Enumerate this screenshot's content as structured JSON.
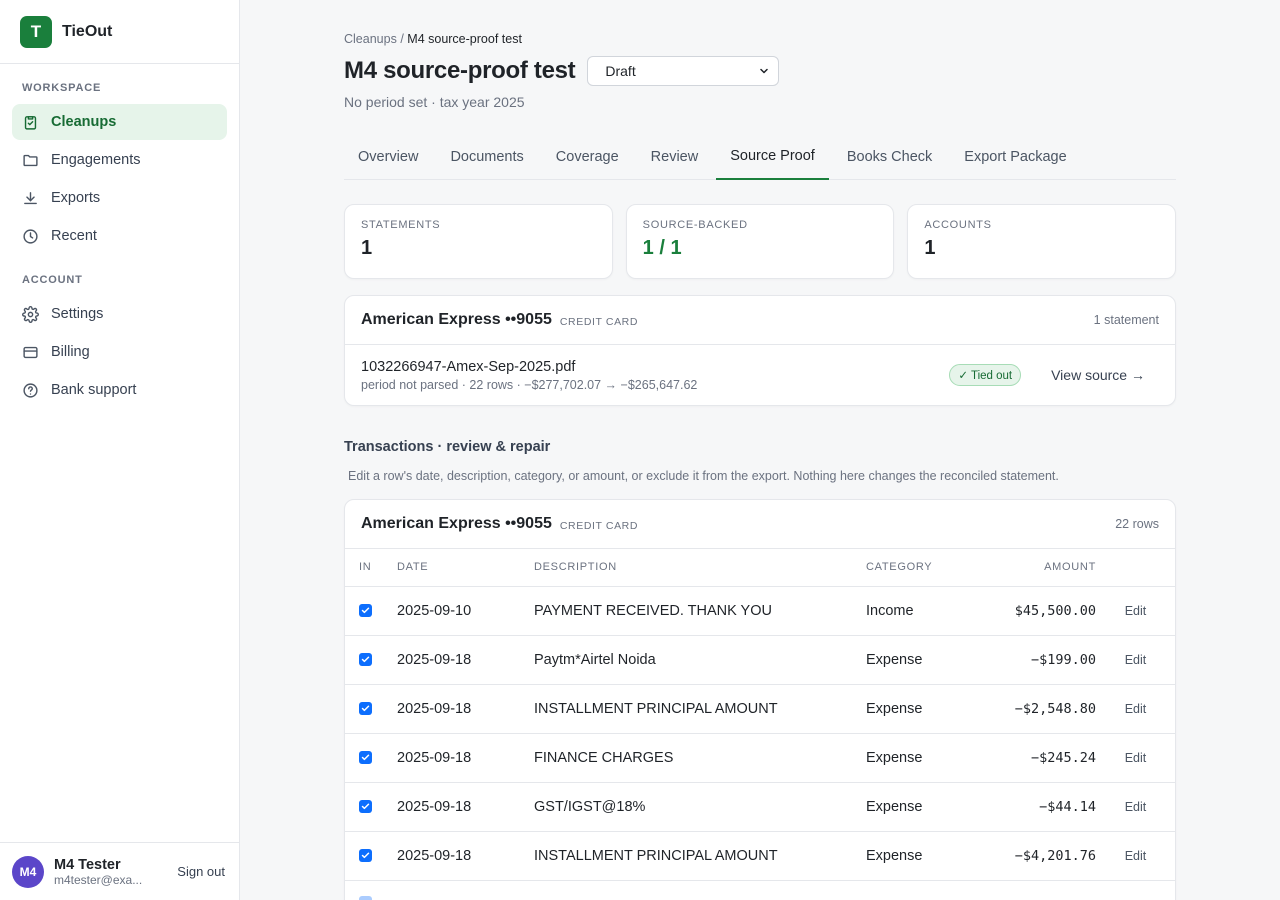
{
  "app": {
    "logo_letter": "T",
    "name": "TieOut"
  },
  "sidebar": {
    "sections": [
      {
        "heading": "WORKSPACE",
        "items": [
          {
            "label": "Cleanups",
            "icon": "check-clipboard-icon",
            "active": true
          },
          {
            "label": "Engagements",
            "icon": "folder-icon",
            "active": false
          },
          {
            "label": "Exports",
            "icon": "download-icon",
            "active": false
          },
          {
            "label": "Recent",
            "icon": "clock-icon",
            "active": false
          }
        ]
      },
      {
        "heading": "ACCOUNT",
        "items": [
          {
            "label": "Settings",
            "icon": "gear-icon",
            "active": false
          },
          {
            "label": "Billing",
            "icon": "credit-card-icon",
            "active": false
          },
          {
            "label": "Bank support",
            "icon": "help-circle-icon",
            "active": false
          }
        ]
      }
    ]
  },
  "user": {
    "initials": "M4",
    "name": "M4 Tester",
    "email": "m4tester@exa...",
    "signout_label": "Sign out"
  },
  "breadcrumb": {
    "parent": "Cleanups",
    "separator": "/",
    "current": "M4 source-proof test"
  },
  "page": {
    "title": "M4 source-proof test",
    "status_value": "Draft",
    "subtitle": "No period set · tax year 2025"
  },
  "tabs": [
    "Overview",
    "Documents",
    "Coverage",
    "Review",
    "Source Proof",
    "Books Check",
    "Export Package"
  ],
  "active_tab": "Source Proof",
  "stats": [
    {
      "label": "STATEMENTS",
      "value": "1"
    },
    {
      "label": "SOURCE-BACKED",
      "value": "1 / 1"
    },
    {
      "label": "ACCOUNTS",
      "value": "1"
    }
  ],
  "account": {
    "name": "American Express ••9055",
    "type": "CREDIT CARD",
    "count": "1 statement",
    "statement": {
      "file": "1032266947-Amex-Sep-2025.pdf",
      "meta": "period not parsed · 22 rows · −$277,702.07 → −$265,647.62",
      "badge": "✓ Tied out",
      "view_label": "View source →"
    }
  },
  "transactions_section": {
    "title": "Transactions · review & repair",
    "description": "Edit a row's date, description, category, or amount, or exclude it from the export. Nothing here changes the reconciled statement."
  },
  "tx_account": {
    "name": "American Express ••9055",
    "type": "CREDIT CARD",
    "count": "22 rows"
  },
  "tx_columns": {
    "in": "IN",
    "date": "DATE",
    "description": "DESCRIPTION",
    "category": "CATEGORY",
    "amount": "AMOUNT"
  },
  "edit_label": "Edit",
  "transactions": [
    {
      "date": "2025-09-10",
      "description": "PAYMENT RECEIVED. THANK YOU",
      "category": "Income",
      "amount": "$45,500.00",
      "included": true
    },
    {
      "date": "2025-09-18",
      "description": "Paytm*Airtel Noida",
      "category": "Expense",
      "amount": "−$199.00",
      "included": true
    },
    {
      "date": "2025-09-18",
      "description": "INSTALLMENT PRINCIPAL AMOUNT",
      "category": "Expense",
      "amount": "−$2,548.80",
      "included": true
    },
    {
      "date": "2025-09-18",
      "description": "FINANCE CHARGES",
      "category": "Expense",
      "amount": "−$245.24",
      "included": true
    },
    {
      "date": "2025-09-18",
      "description": "GST/IGST@18%",
      "category": "Expense",
      "amount": "−$44.14",
      "included": true
    },
    {
      "date": "2025-09-18",
      "description": "INSTALLMENT PRINCIPAL AMOUNT",
      "category": "Expense",
      "amount": "−$4,201.76",
      "included": true
    }
  ],
  "colors": {
    "brand": "#1a7f3c",
    "brand_bg": "#e6f4ea",
    "avatar": "#5b46c9",
    "checkbox": "#0d6efd"
  }
}
